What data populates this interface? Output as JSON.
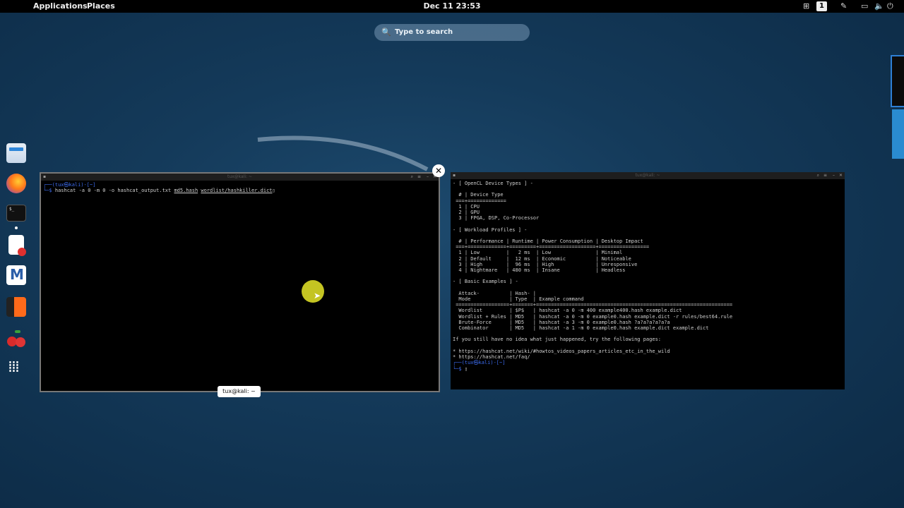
{
  "topbar": {
    "applications": "Applications",
    "places": "Places",
    "clock": "Dec 11  23:53",
    "workspace": "1"
  },
  "search": {
    "placeholder": "Type to search"
  },
  "dock": {
    "items": [
      "file-manager",
      "firefox",
      "terminal",
      "text-editor",
      "metasploit",
      "burpsuite",
      "cherrytree",
      "app-grid"
    ]
  },
  "left_terminal": {
    "title": "tux@kali: ~",
    "prompt_user": "┌──(tux㉿kali)-[~]",
    "prompt_line_prefix": "└─$ ",
    "command_a": "hashcat -a 0 -m 0 -o hashcat_output.txt ",
    "command_b": "md5.hash",
    "command_c": "wordlist/hashkiller.dict",
    "tooltip": "tux@kali: ~"
  },
  "right_terminal": {
    "title": "tux@kali: ~",
    "output": "- [ OpenCL Device Types ] -\n\n  # | Device Type\n ===+=============\n  1 | CPU\n  2 | GPU\n  3 | FPGA, DSP, Co-Processor\n\n- [ Workload Profiles ] -\n\n  # | Performance | Runtime | Power Consumption | Desktop Impact\n ===+=============+=========+===================+=================\n  1 | Low         |   2 ms  | Low               | Minimal\n  2 | Default     |  12 ms  | Economic          | Noticeable\n  3 | High        |  96 ms  | High              | Unresponsive\n  4 | Nightmare   | 480 ms  | Insane            | Headless\n\n- [ Basic Examples ] -\n\n  Attack-          | Hash- |\n  Mode             | Type  | Example command\n ==================+=======+==================================================================\n  Wordlist         | $P$   | hashcat -a 0 -m 400 example400.hash example.dict\n  Wordlist + Rules | MD5   | hashcat -a 0 -m 0 example0.hash example.dict -r rules/best64.rule\n  Brute-Force      | MD5   | hashcat -a 3 -m 0 example0.hash ?a?a?a?a?a?a\n  Combinator       | MD5   | hashcat -a 1 -m 0 example0.hash example.dict example.dict\n\nIf you still have no idea what just happened, try the following pages:\n\n* https://hashcat.net/wiki/#howtos_videos_papers_articles_etc_in_the_wild\n* https://hashcat.net/faq/\n",
    "prompt_user": "┌──(tux㉿kali)-[~]",
    "prompt_line_prefix": "└─$ "
  },
  "colors": {
    "accent": "#2e7fd4",
    "prompt": "#3d6cf0"
  }
}
